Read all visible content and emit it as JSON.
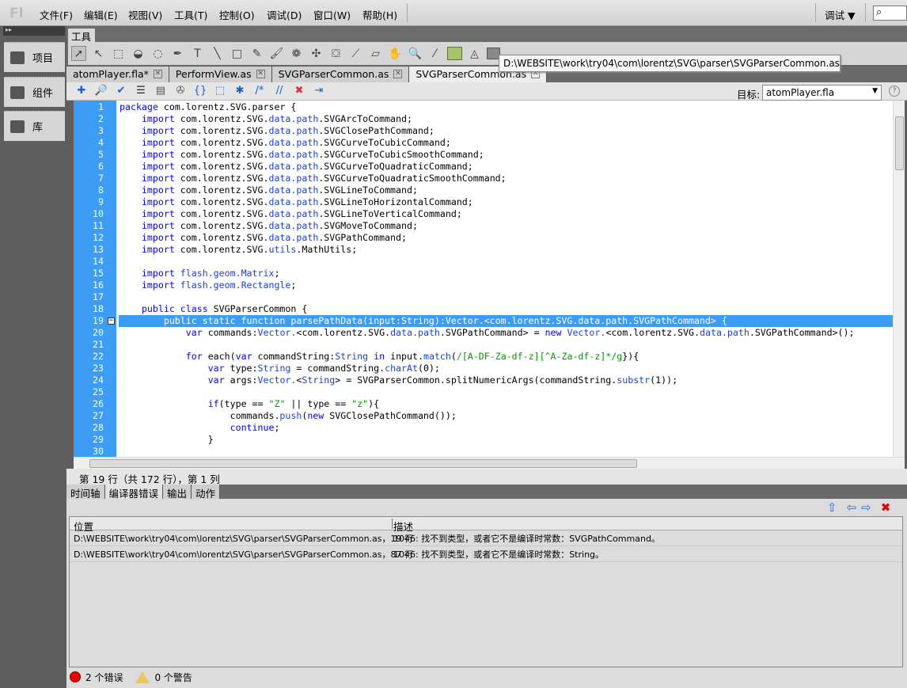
{
  "app": {
    "logo": "Fl"
  },
  "menu": [
    "文件(F)",
    "编辑(E)",
    "视图(V)",
    "工具(T)",
    "控制(O)",
    "调试(D)",
    "窗口(W)",
    "帮助(H)"
  ],
  "workspace": {
    "label": "调试 ▼",
    "search_icon": "⌕"
  },
  "left_panel": {
    "items": [
      "项目",
      "组件",
      "库"
    ]
  },
  "tools": {
    "tab": "工具",
    "fill_color": "#a7c46a",
    "tooltip": "D:\\WEBSITE\\work\\try04\\com\\lorentz\\SVG\\parser\\SVGParserCommon.as"
  },
  "doc_tabs": [
    {
      "label": "atomPlayer.fla*"
    },
    {
      "label": "PerformView.as"
    },
    {
      "label": "SVGParserCommon.as"
    },
    {
      "label": "SVGParserCommon.as",
      "active": true
    }
  ],
  "script_toolbar": {
    "target_label": "目标:",
    "target_value": "atomPlayer.fla",
    "help": "?"
  },
  "code": [
    {
      "n": "1",
      "t": [
        [
          "k",
          "package"
        ],
        [
          "n",
          " com.lorentz.SVG.parser {"
        ]
      ]
    },
    {
      "n": "2",
      "t": [
        [
          "n",
          "    "
        ],
        [
          "k",
          "import"
        ],
        [
          "n",
          " com.lorentz.SVG."
        ],
        [
          "t",
          "data.path"
        ],
        [
          "n",
          ".SVGArcToCommand;"
        ]
      ]
    },
    {
      "n": "3",
      "t": [
        [
          "n",
          "    "
        ],
        [
          "k",
          "import"
        ],
        [
          "n",
          " com.lorentz.SVG."
        ],
        [
          "t",
          "data.path"
        ],
        [
          "n",
          ".SVGClosePathCommand;"
        ]
      ]
    },
    {
      "n": "4",
      "t": [
        [
          "n",
          "    "
        ],
        [
          "k",
          "import"
        ],
        [
          "n",
          " com.lorentz.SVG."
        ],
        [
          "t",
          "data.path"
        ],
        [
          "n",
          ".SVGCurveToCubicCommand;"
        ]
      ]
    },
    {
      "n": "5",
      "t": [
        [
          "n",
          "    "
        ],
        [
          "k",
          "import"
        ],
        [
          "n",
          " com.lorentz.SVG."
        ],
        [
          "t",
          "data.path"
        ],
        [
          "n",
          ".SVGCurveToCubicSmoothCommand;"
        ]
      ]
    },
    {
      "n": "6",
      "t": [
        [
          "n",
          "    "
        ],
        [
          "k",
          "import"
        ],
        [
          "n",
          " com.lorentz.SVG."
        ],
        [
          "t",
          "data.path"
        ],
        [
          "n",
          ".SVGCurveToQuadraticCommand;"
        ]
      ]
    },
    {
      "n": "7",
      "t": [
        [
          "n",
          "    "
        ],
        [
          "k",
          "import"
        ],
        [
          "n",
          " com.lorentz.SVG."
        ],
        [
          "t",
          "data.path"
        ],
        [
          "n",
          ".SVGCurveToQuadraticSmoothCommand;"
        ]
      ]
    },
    {
      "n": "8",
      "t": [
        [
          "n",
          "    "
        ],
        [
          "k",
          "import"
        ],
        [
          "n",
          " com.lorentz.SVG."
        ],
        [
          "t",
          "data.path"
        ],
        [
          "n",
          ".SVGLineToCommand;"
        ]
      ]
    },
    {
      "n": "9",
      "t": [
        [
          "n",
          "    "
        ],
        [
          "k",
          "import"
        ],
        [
          "n",
          " com.lorentz.SVG."
        ],
        [
          "t",
          "data.path"
        ],
        [
          "n",
          ".SVGLineToHorizontalCommand;"
        ]
      ]
    },
    {
      "n": "10",
      "t": [
        [
          "n",
          "    "
        ],
        [
          "k",
          "import"
        ],
        [
          "n",
          " com.lorentz.SVG."
        ],
        [
          "t",
          "data.path"
        ],
        [
          "n",
          ".SVGLineToVerticalCommand;"
        ]
      ]
    },
    {
      "n": "11",
      "t": [
        [
          "n",
          "    "
        ],
        [
          "k",
          "import"
        ],
        [
          "n",
          " com.lorentz.SVG."
        ],
        [
          "t",
          "data.path"
        ],
        [
          "n",
          ".SVGMoveToCommand;"
        ]
      ]
    },
    {
      "n": "12",
      "t": [
        [
          "n",
          "    "
        ],
        [
          "k",
          "import"
        ],
        [
          "n",
          " com.lorentz.SVG."
        ],
        [
          "t",
          "data.path"
        ],
        [
          "n",
          ".SVGPathCommand;"
        ]
      ]
    },
    {
      "n": "13",
      "t": [
        [
          "n",
          "    "
        ],
        [
          "k",
          "import"
        ],
        [
          "n",
          " com.lorentz.SVG."
        ],
        [
          "t",
          "utils"
        ],
        [
          "n",
          ".MathUtils;"
        ]
      ]
    },
    {
      "n": "14",
      "t": []
    },
    {
      "n": "15",
      "t": [
        [
          "n",
          "    "
        ],
        [
          "k",
          "import"
        ],
        [
          "n",
          " "
        ],
        [
          "t",
          "flash.geom.Matrix"
        ],
        [
          "n",
          ";"
        ]
      ]
    },
    {
      "n": "16",
      "t": [
        [
          "n",
          "    "
        ],
        [
          "k",
          "import"
        ],
        [
          "n",
          " "
        ],
        [
          "t",
          "flash.geom.Rectangle"
        ],
        [
          "n",
          ";"
        ]
      ]
    },
    {
      "n": "17",
      "t": []
    },
    {
      "n": "18",
      "t": [
        [
          "n",
          "    "
        ],
        [
          "k",
          "public class"
        ],
        [
          "n",
          " SVGParserCommon {"
        ]
      ]
    },
    {
      "n": "19",
      "hl": true,
      "t": [
        [
          "n",
          "        public static function parsePathData(input:String):Vector.<com.lorentz.SVG.data.path.SVGPathCommand> {"
        ]
      ]
    },
    {
      "n": "20",
      "t": [
        [
          "n",
          "            "
        ],
        [
          "k",
          "var"
        ],
        [
          "n",
          " commands:"
        ],
        [
          "t",
          "Vector."
        ],
        [
          "n",
          "<com.lorentz.SVG."
        ],
        [
          "t",
          "data.path"
        ],
        [
          "n",
          ".SVGPathCommand> = "
        ],
        [
          "k",
          "new"
        ],
        [
          "n",
          " "
        ],
        [
          "t",
          "Vector."
        ],
        [
          "n",
          "<com.lorentz.SVG."
        ],
        [
          "t",
          "data.path"
        ],
        [
          "n",
          ".SVGPathCommand>();"
        ]
      ]
    },
    {
      "n": "21",
      "t": []
    },
    {
      "n": "22",
      "t": [
        [
          "n",
          "            "
        ],
        [
          "k",
          "for"
        ],
        [
          "n",
          " each("
        ],
        [
          "k",
          "var"
        ],
        [
          "n",
          " commandString:"
        ],
        [
          "t",
          "String"
        ],
        [
          "n",
          " "
        ],
        [
          "k",
          "in"
        ],
        [
          "n",
          " input."
        ],
        [
          "t",
          "match"
        ],
        [
          "n",
          "("
        ],
        [
          "s",
          "/[A-DF-Za-df-z][^A-Za-df-z]*/g"
        ],
        [
          "n",
          "}){"
        ]
      ]
    },
    {
      "n": "23",
      "t": [
        [
          "n",
          "                "
        ],
        [
          "k",
          "var"
        ],
        [
          "n",
          " type:"
        ],
        [
          "t",
          "String"
        ],
        [
          "n",
          " = commandString."
        ],
        [
          "t",
          "charAt"
        ],
        [
          "n",
          "(0);"
        ]
      ]
    },
    {
      "n": "24",
      "t": [
        [
          "n",
          "                "
        ],
        [
          "k",
          "var"
        ],
        [
          "n",
          " args:"
        ],
        [
          "t",
          "Vector."
        ],
        [
          "n",
          "<"
        ],
        [
          "t",
          "String"
        ],
        [
          "n",
          "> = SVGParserCommon.splitNumericArgs(commandString."
        ],
        [
          "t",
          "substr"
        ],
        [
          "n",
          "(1));"
        ]
      ]
    },
    {
      "n": "25",
      "t": []
    },
    {
      "n": "26",
      "t": [
        [
          "n",
          "                "
        ],
        [
          "k",
          "if"
        ],
        [
          "n",
          "(type == "
        ],
        [
          "s",
          "\"Z\""
        ],
        [
          "n",
          " || type == "
        ],
        [
          "s",
          "\"z\""
        ],
        [
          "n",
          "){"
        ]
      ]
    },
    {
      "n": "27",
      "t": [
        [
          "n",
          "                    commands."
        ],
        [
          "t",
          "push"
        ],
        [
          "n",
          "("
        ],
        [
          "k",
          "new"
        ],
        [
          "n",
          " SVGClosePathCommand());"
        ]
      ]
    },
    {
      "n": "28",
      "t": [
        [
          "n",
          "                    "
        ],
        [
          "k",
          "continue"
        ],
        [
          "n",
          ";"
        ]
      ]
    },
    {
      "n": "29",
      "t": [
        [
          "n",
          "                }"
        ]
      ]
    },
    {
      "n": "30",
      "t": []
    }
  ],
  "status": "第 19 行（共 172 行），第 1 列",
  "panel_tabs": [
    {
      "label": "时间轴"
    },
    {
      "label": "编译器错误",
      "active": true
    },
    {
      "label": "输出"
    },
    {
      "label": "动作"
    }
  ],
  "errors": {
    "columns": [
      "位置",
      "描述"
    ],
    "rows": [
      {
        "location": "D:\\WEBSITE\\work\\try04\\com\\lorentz\\SVG\\parser\\SVGParserCommon.as，19 行",
        "description": "1046: 找不到类型，或者它不是编译时常数：SVGPathCommand。"
      },
      {
        "location": "D:\\WEBSITE\\work\\try04\\com\\lorentz\\SVG\\parser\\SVGParserCommon.as，87 行",
        "description": "1046: 找不到类型，或者它不是编译时常数：String。"
      }
    ],
    "error_count": "2 个错误",
    "warning_count": "0 个警告"
  }
}
